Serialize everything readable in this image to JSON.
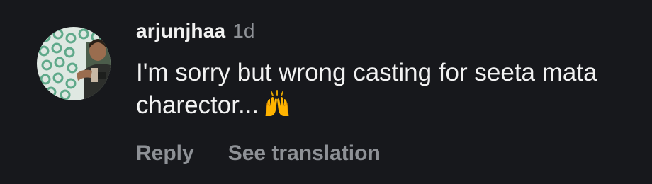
{
  "comment": {
    "username": "arjunjhaa",
    "time": "1d",
    "text": "I'm sorry but wrong casting for seeta mata charector...",
    "emoji": "raising-hands-emoji",
    "actions": {
      "reply": "Reply",
      "see_translation": "See translation"
    }
  },
  "colors": {
    "background": "#17181c",
    "text_primary": "#f2f2f2",
    "text_secondary": "#8e9196"
  }
}
